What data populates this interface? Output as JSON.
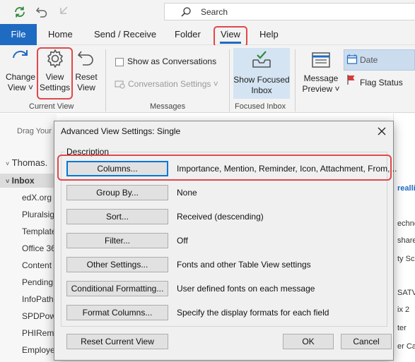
{
  "titlebar": {
    "search_placeholder": "Search",
    "icons": [
      "sync-icon",
      "undo-icon",
      "redo-icon",
      "search-icon"
    ]
  },
  "ribbon_tabs": [
    "File",
    "Home",
    "Send / Receive",
    "Folder",
    "View",
    "Help"
  ],
  "ribbon": {
    "change_view": [
      "Change",
      "View"
    ],
    "view_settings": [
      "View",
      "Settings"
    ],
    "reset_view": [
      "Reset",
      "View"
    ],
    "current_view_group": "Current View",
    "show_as_conversations": "Show as Conversations",
    "conversation_settings": "Conversation Settings",
    "messages_group": "Messages",
    "show_focused_inbox": [
      "Show Focused",
      "Inbox"
    ],
    "focused_inbox_group": "Focused Inbox",
    "message_preview": [
      "Message",
      "Preview"
    ],
    "arrangement_date": "Date",
    "arrangement_flag": "Flag Status"
  },
  "folder_pane": {
    "drag_hint": "Drag Your",
    "account": "Thomas.",
    "inbox": "Inbox",
    "folders": [
      "edX.org",
      "Pluralsig",
      "Template",
      "Office 36",
      "Content",
      "Pending",
      "InfoPath",
      "SPDPow",
      "PHIReme",
      "Employe"
    ]
  },
  "right_fragments": [
    "realli",
    "echno",
    "share",
    "ty Sc",
    "SATV",
    "ix 2",
    "ter",
    "er Ca"
  ],
  "dialog": {
    "title": "Advanced View Settings: Single",
    "description_legend": "Description",
    "rows": [
      {
        "button": "Columns...",
        "value": "Importance, Mention, Reminder, Icon, Attachment, From,..."
      },
      {
        "button": "Group By...",
        "value": "None"
      },
      {
        "button": "Sort...",
        "value": "Received (descending)"
      },
      {
        "button": "Filter...",
        "value": "Off"
      },
      {
        "button": "Other Settings...",
        "value": "Fonts and other Table View settings"
      },
      {
        "button": "Conditional Formatting...",
        "value": "User defined fonts on each message"
      },
      {
        "button": "Format Columns...",
        "value": "Specify the display formats for each field"
      }
    ],
    "reset_button": "Reset Current View",
    "ok_button": "OK",
    "cancel_button": "Cancel"
  },
  "colors": {
    "accent_blue": "#1f6bc1",
    "highlight_red": "#e0484c",
    "dialog_bg": "#f0f0f0",
    "ribbon_bg": "#f3f3f3"
  }
}
